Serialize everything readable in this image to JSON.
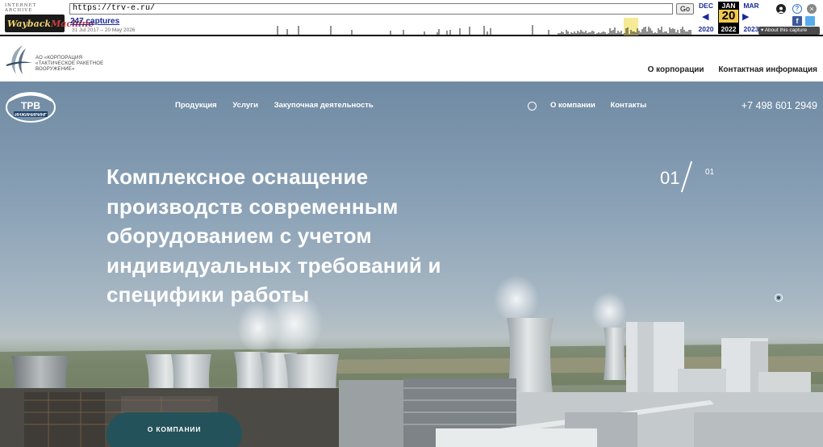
{
  "wayback": {
    "ia_label": "INTERNET ARCHIVE",
    "logo_word1": "Wayback",
    "logo_word2": "Machine",
    "url": "https://trv-e.ru/",
    "go": "Go",
    "captures": "247 captures",
    "range": "31 Jul 2017 – 20 May 2026",
    "prev_month": "DEC",
    "cur_month": "JAN",
    "next_month": "MAR",
    "cur_day": "20",
    "prev_year": "2020",
    "cur_year": "2022",
    "next_year": "2023",
    "about": "▾ About this capture"
  },
  "site": {
    "corp_name_line1": "АО «КОРПОРАЦИЯ",
    "corp_name_line2": "«ТАКТИЧЕСКОЕ РАКЕТНОЕ",
    "corp_name_line3": "ВООРУЖЕНИЕ»",
    "top_nav": [
      "О корпорации",
      "Контактная информация"
    ],
    "trv_logo_text": "ТРВ",
    "trv_logo_sub": "ИНЖИНИРИНГ",
    "main_nav": [
      "Продукция",
      "Услуги",
      "Закупочная деятельность"
    ],
    "right_nav": [
      "О компании",
      "Контакты"
    ],
    "phone": "+7 498 601 2949",
    "headline": "Комплексное оснащение производств современным оборудованием с учетом индивидуальных требований и специфики работы",
    "slide_current": "01",
    "slide_total": "01",
    "cta": "О КОМПАНИИ"
  },
  "colors": {
    "cta_bg": "#24525a",
    "calendar_highlight": "#f2c94c",
    "link_blue": "#1a2a9a"
  }
}
